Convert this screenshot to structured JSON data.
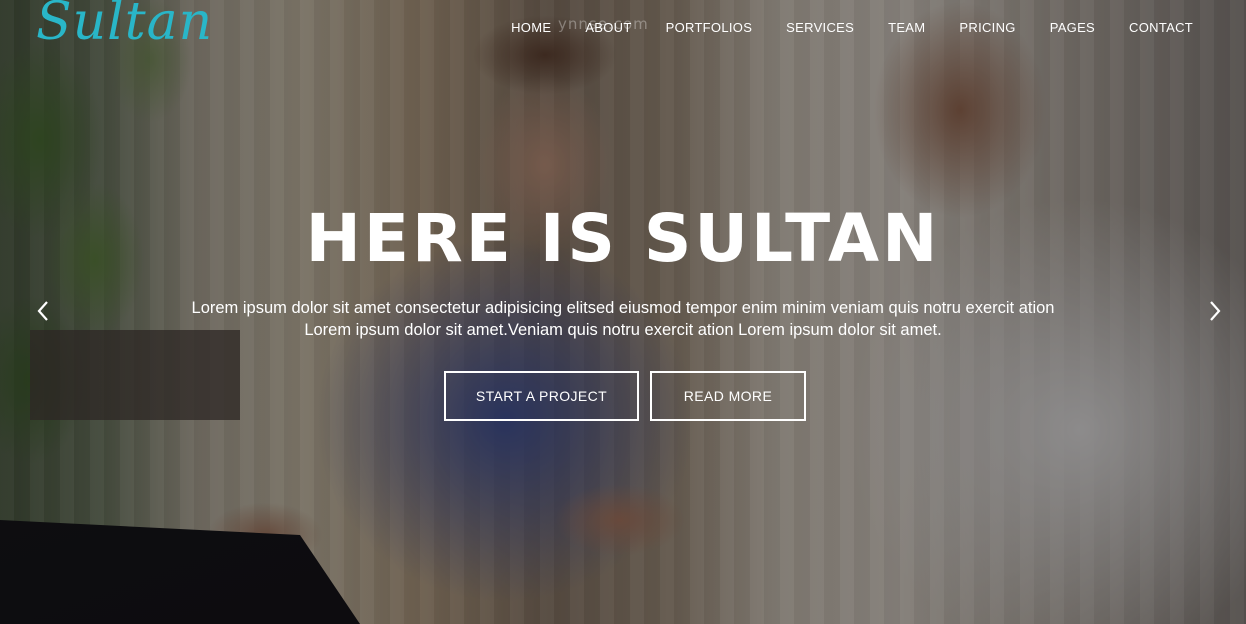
{
  "header": {
    "logo": "Sultan",
    "watermark": "ynnse.com",
    "nav": [
      {
        "label": "HOME"
      },
      {
        "label": "ABOUT"
      },
      {
        "label": "PORTFOLIOS"
      },
      {
        "label": "SERVICES"
      },
      {
        "label": "TEAM"
      },
      {
        "label": "PRICING"
      },
      {
        "label": "PAGES"
      },
      {
        "label": "CONTACT"
      }
    ]
  },
  "hero": {
    "title": "HERE IS SULTAN",
    "text_line1": "Lorem ipsum dolor sit amet consectetur adipisicing elitsed eiusmod tempor enim minim veniam quis notru exercit ation",
    "text_line2": "Lorem ipsum dolor sit amet.Veniam quis notru exercit ation Lorem ipsum dolor sit amet.",
    "primary_button": "START A PROJECT",
    "secondary_button": "READ MORE"
  },
  "carousel": {
    "prev_icon": "chevron-left-icon",
    "next_icon": "chevron-right-icon"
  },
  "colors": {
    "logo": "#29b6c8",
    "text": "#ffffff"
  }
}
